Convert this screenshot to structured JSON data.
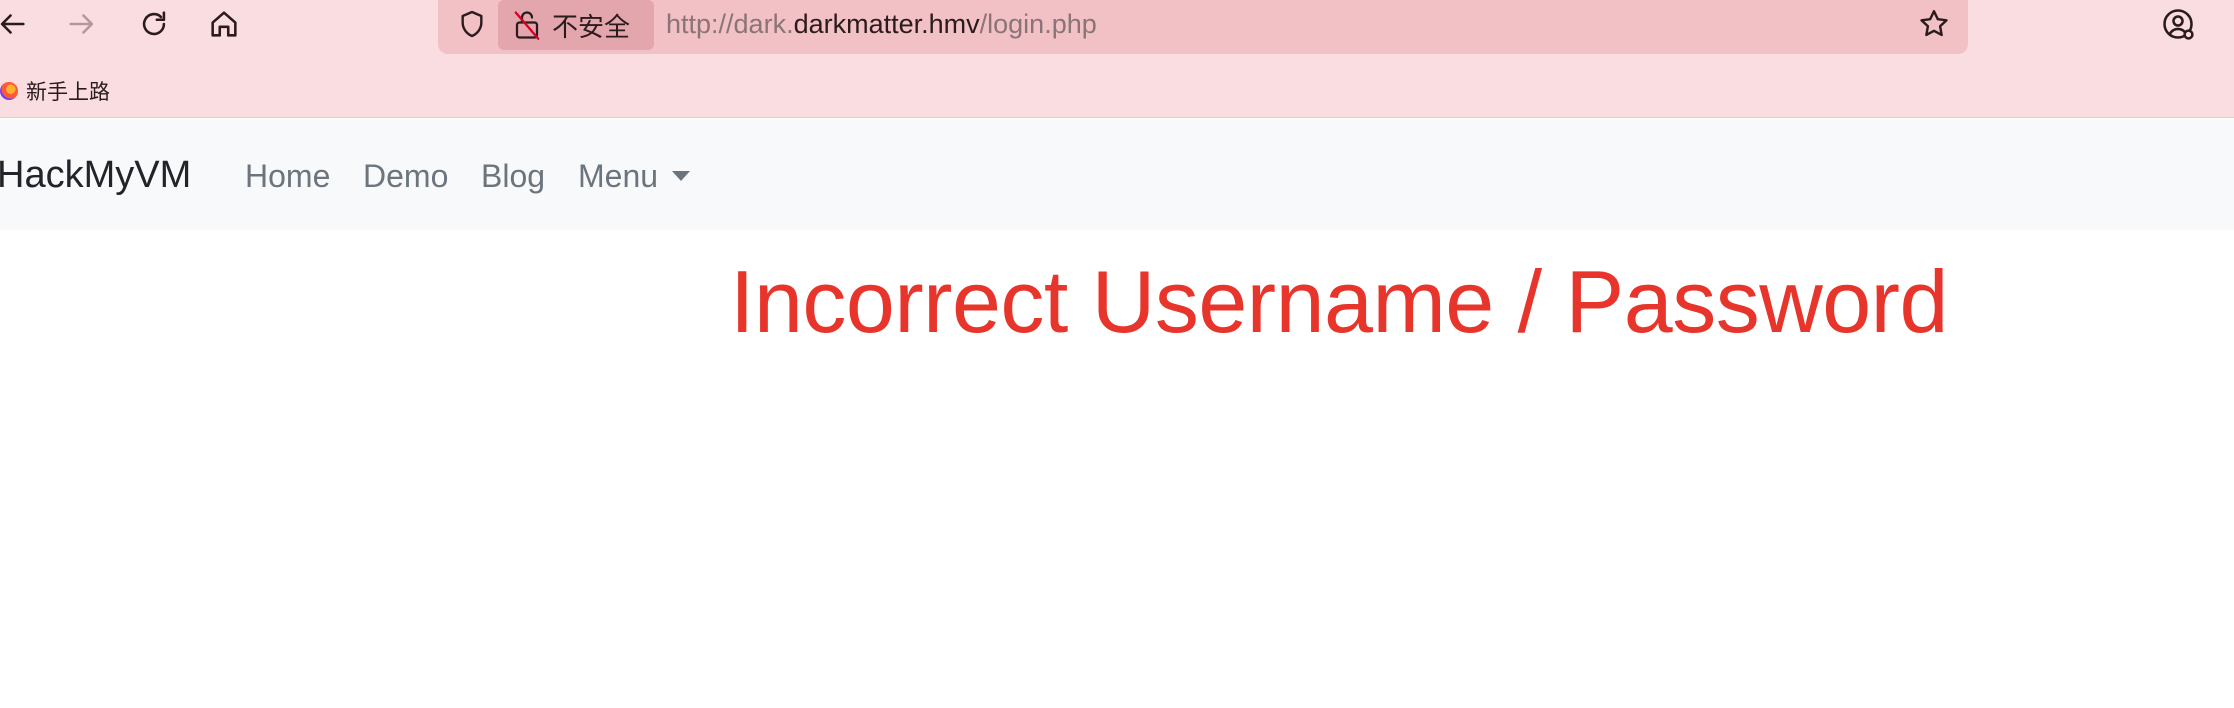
{
  "browser": {
    "url_prefix": "http://dark.",
    "url_domain": "darkmatter.hmv",
    "url_path": "/login.php",
    "security_label": "不安全",
    "bookmarks": [
      {
        "label": "新手上路"
      }
    ],
    "icons": {
      "back": "arrow-left-icon",
      "forward": "arrow-right-icon",
      "reload": "reload-icon",
      "home": "home-icon",
      "shield": "shield-icon",
      "lock": "lock-slash-icon",
      "star": "star-icon",
      "account": "account-icon"
    },
    "colors": {
      "toolbar": "#f9dde0",
      "urlbar": "#f2c1c6",
      "insecure_chip": "#e3a6ad"
    }
  },
  "site": {
    "brand": "HackMyVM",
    "nav": [
      {
        "label": "Home"
      },
      {
        "label": "Demo"
      },
      {
        "label": "Blog"
      },
      {
        "label": "Menu"
      }
    ],
    "message": "Incorrect Username / Password",
    "colors": {
      "navbar_bg": "#f8f9fa",
      "nav_link": "#6c757d",
      "brand": "#212529",
      "message": "#e8352b"
    }
  }
}
